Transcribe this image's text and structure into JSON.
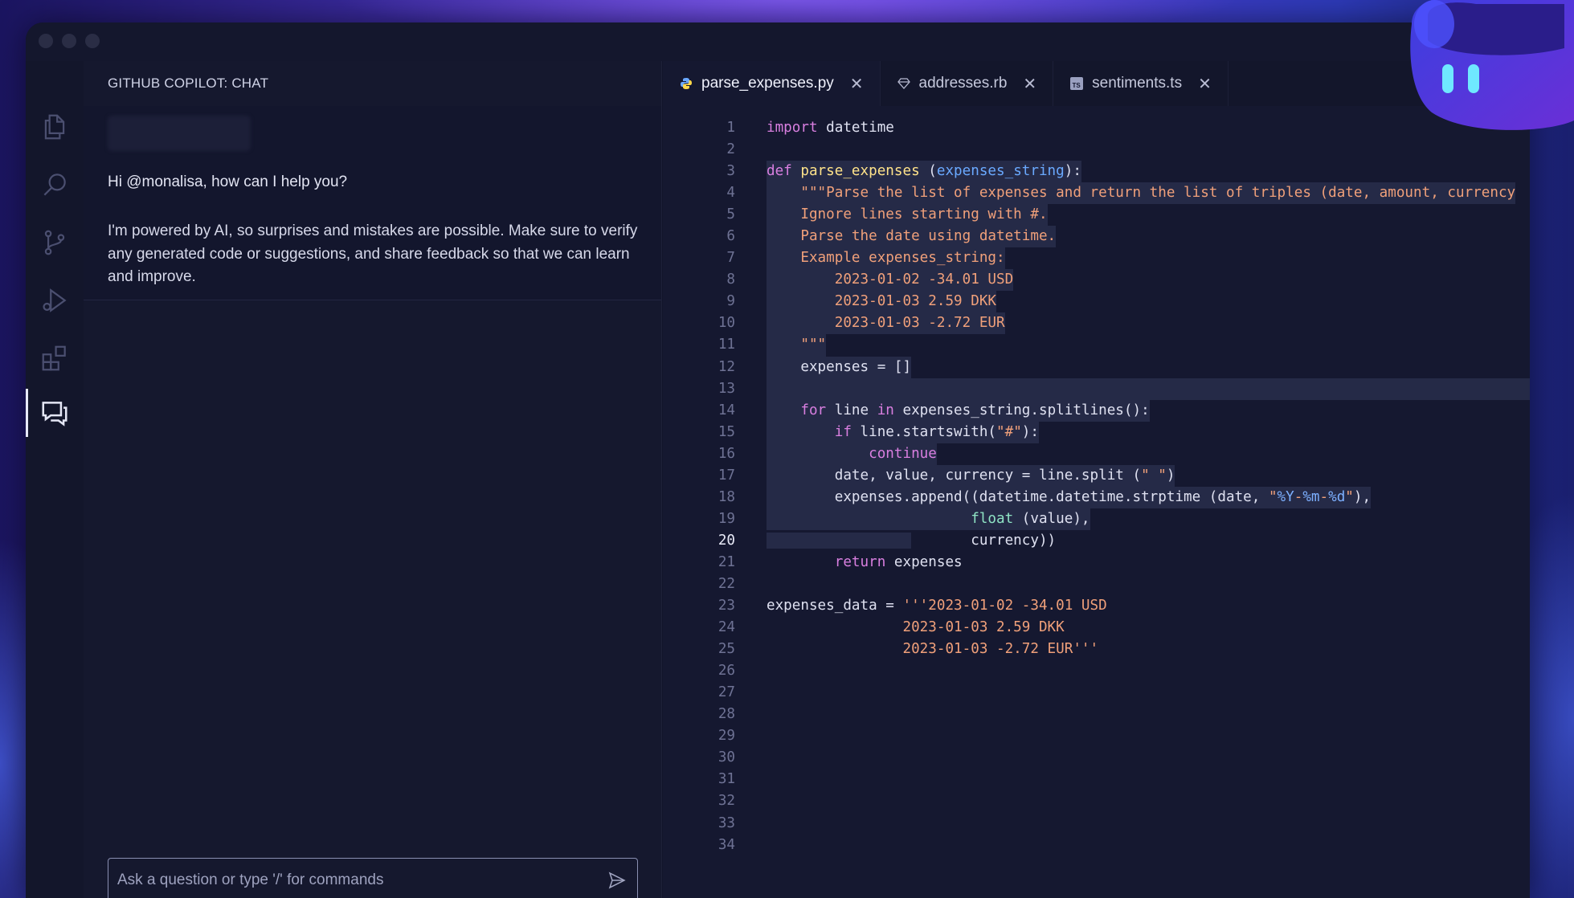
{
  "chat": {
    "header": "GITHUB COPILOT: CHAT",
    "greeting": "Hi @monalisa, how can I help you?",
    "disclaimer": "I'm powered by AI, so surprises and mistakes are possible. Make sure to verify any generated code or suggestions, and share feedback so that we can learn and improve.",
    "input_placeholder": "Ask a question or type '/' for commands"
  },
  "activity_bar": {
    "icons": [
      "explorer-icon",
      "search-icon",
      "source-control-icon",
      "run-debug-icon",
      "extensions-icon",
      "chat-icon"
    ],
    "active": "chat-icon"
  },
  "tabs": [
    {
      "label": "parse_expenses.py",
      "icon": "python-icon",
      "active": true
    },
    {
      "label": "addresses.rb",
      "icon": "ruby-icon",
      "active": false
    },
    {
      "label": "sentiments.ts",
      "icon": "typescript-icon",
      "active": false
    }
  ],
  "editor": {
    "current_line": 20,
    "line_numbers": [
      "1",
      "2",
      "3",
      "4",
      "5",
      "6",
      "7",
      "8",
      "9",
      "10",
      "11",
      "12",
      "13",
      "14",
      "15",
      "16",
      "17",
      "18",
      "19",
      "20",
      "21",
      "22",
      "23",
      "24",
      "25",
      "26",
      "27",
      "28",
      "29",
      "30",
      "31",
      "32",
      "33",
      "34"
    ],
    "lines": [
      "import datetime",
      "",
      "def parse_expenses (expenses_string):",
      "    \"\"\"Parse the list of expenses and return the list of triples (date, amount, currency",
      "    Ignore lines starting with #.",
      "    Parse the date using datetime.",
      "    Example expenses_string:",
      "        2023-01-02 -34.01 USD",
      "        2023-01-03 2.59 DKK",
      "        2023-01-03 -2.72 EUR",
      "    \"\"\"",
      "    expenses = []",
      "",
      "    for line in expenses_string.splitlines():",
      "        if line.startswith(\"#\"):",
      "            continue",
      "        date, value, currency = line.split (\" \")",
      "        expenses.append((datetime.datetime.strptime (date, \"%Y-%m-%d\"),",
      "                        float (value),",
      "                        currency))",
      "        return expenses",
      "",
      "expenses_data = '''2023-01-02 -34.01 USD",
      "                2023-01-03 2.59 DKK",
      "                2023-01-03 -2.72 EUR'''",
      "",
      "",
      "",
      "",
      "",
      "",
      "",
      "",
      ""
    ]
  },
  "colors": {
    "keyword": "#d97fe0",
    "function": "#ffe38a",
    "parameter": "#6aa9ff",
    "string": "#f0a07a",
    "builtin": "#8fe3c4",
    "selection": "#252a47"
  }
}
